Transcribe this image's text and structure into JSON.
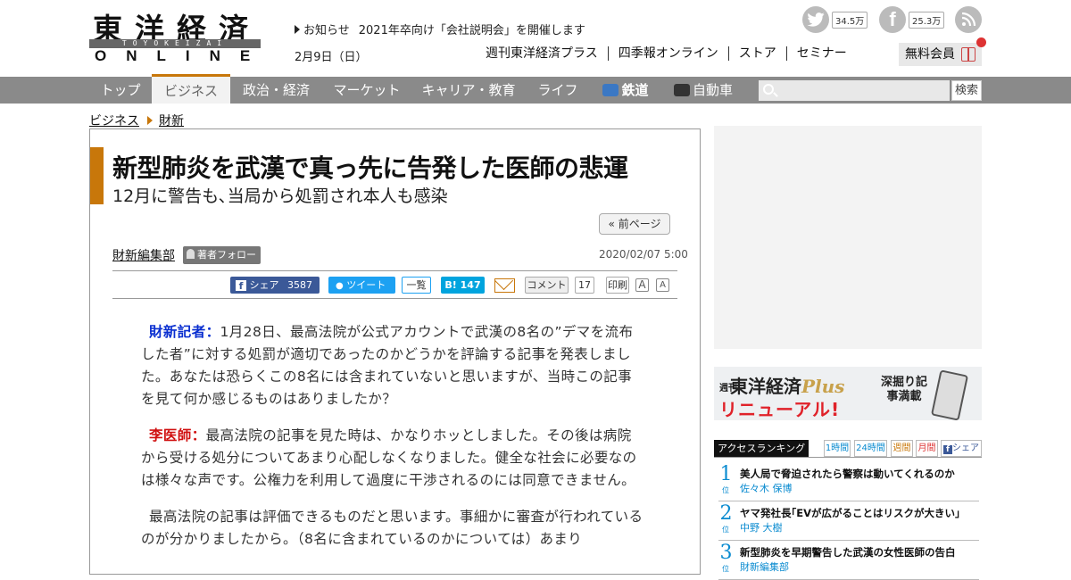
{
  "header": {
    "logo_kanji": "東洋経済",
    "logo_band": "TOYOKEIZAI",
    "logo_online": "ONLINE",
    "notice_label": "お知らせ",
    "notice_text": "2021年卒向け「会社説明会」を開催します",
    "date": "2月9日（日）",
    "top_links": [
      "週刊東洋経済プラス",
      "四季報オンライン",
      "ストア",
      "セミナー"
    ],
    "twitter_count": "34.5万",
    "facebook_count": "25.3万",
    "member_label": "無料会員",
    "icons": {
      "twitter": "twitter-icon",
      "facebook": "facebook-icon",
      "rss": "rss-icon",
      "gift": "gift-icon"
    }
  },
  "nav": {
    "items": [
      "トップ",
      "ビジネス",
      "政治・経済",
      "マーケット",
      "キャリア・教育",
      "ライフ",
      "鉄道",
      "自動車"
    ],
    "active": "ビジネス",
    "search_button": "検索",
    "search_placeholder": ""
  },
  "breadcrumb": [
    "ビジネス",
    "財新"
  ],
  "article": {
    "title": "新型肺炎を武漢で真っ先に告発した医師の悲運",
    "subtitle": "12月に警告も､当局から処罰され本人も感染",
    "prev_page": "« 前ページ",
    "author": "財新編集部",
    "follow_label": "著者フォロー",
    "published": "2020/02/07 5:00",
    "share": {
      "facebook_label": "シェア",
      "facebook_count": "3587",
      "tweet_label": "ツイート",
      "list_label": "一覧",
      "hatena_count": "147",
      "comment_label": "コメント",
      "comment_count": "17",
      "print_label": "印刷",
      "font_a": "A"
    },
    "paragraphs": [
      {
        "speaker": "財新記者：",
        "text": "1月28日、最高法院が公式アカウントで武漢の8名の”デマを流布した者”に対する処罰が適切であったのかどうかを評論する記事を発表しました。あなたは恐らくこの8名には含まれていないと思いますが、当時この記事を見て何か感じるものはありましたか？"
      },
      {
        "speaker": "李医師：",
        "text": "最高法院の記事を見た時は、かなりホッとしました。その後は病院から受ける処分についてあまり心配しなくなりました。健全な社会に必要なのは様々な声です。公権力を利用して過度に干渉されるのには同意できません。"
      },
      {
        "speaker": "",
        "text": "最高法院の記事は評価できるものだと思います。事細かに審査が行われているのが分かりましたから。（8名に含まれているのかについては）あまり"
      }
    ]
  },
  "sidebar": {
    "banner": {
      "brand_prefix": "週刊",
      "brand": "東洋経済",
      "brand_plus": "Plus",
      "renewal": "リニューアル!",
      "tagline": "深掘り記事満載"
    },
    "ranking": {
      "label": "アクセスランキング",
      "tabs": [
        "1時間",
        "24時間",
        "週間",
        "月間",
        "シェア"
      ],
      "position_suffix": "位",
      "items": [
        {
          "rank": "1",
          "title": "美人局で脅迫されたら警察は動いてくれるのか",
          "author": "佐々木 保博"
        },
        {
          "rank": "2",
          "title": "ヤマ発社長｢EVが広がることはリスクが大きい｣",
          "author": "中野 大樹"
        },
        {
          "rank": "3",
          "title": "新型肺炎を早期警告した武漢の女性医師の告白",
          "author": "財新編集部"
        }
      ]
    }
  }
}
